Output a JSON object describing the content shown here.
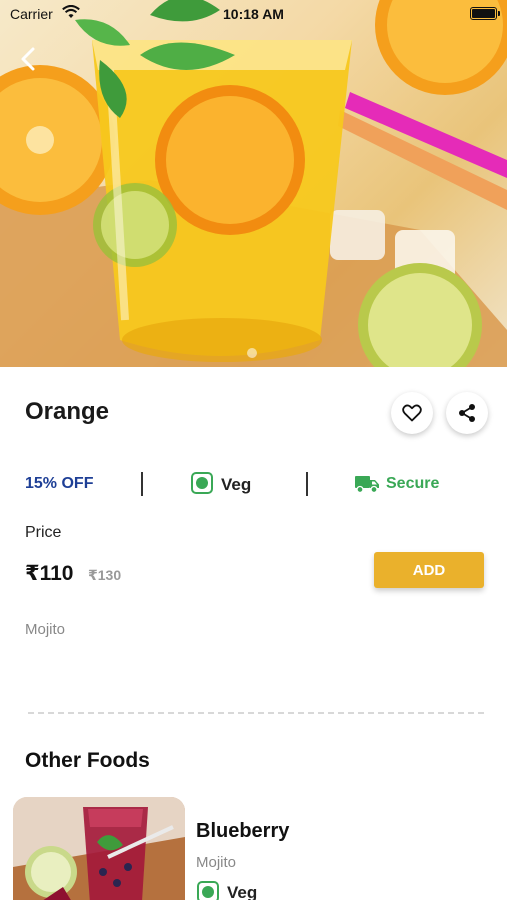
{
  "status_bar": {
    "carrier": "Carrier",
    "time": "10:18 AM"
  },
  "product": {
    "name": "Orange",
    "discount": "15% OFF",
    "diet": "Veg",
    "secure": "Secure",
    "price_label": "Price",
    "price": "₹110",
    "old_price": "₹130",
    "description": "Mojito",
    "add_label": "ADD"
  },
  "other_foods": {
    "title": "Other Foods",
    "items": [
      {
        "name": "Blueberry",
        "description": "Mojito",
        "diet": "Veg"
      }
    ]
  },
  "colors": {
    "accent": "#eab12c",
    "discount": "#1e3f96",
    "veg_green": "#3aa856"
  },
  "icons": [
    "back-arrow-icon",
    "wifi-icon",
    "battery-icon",
    "heart-icon",
    "share-icon",
    "veg-icon",
    "truck-icon"
  ]
}
